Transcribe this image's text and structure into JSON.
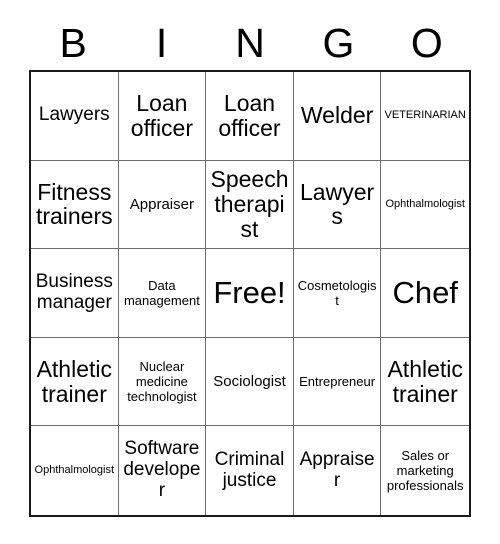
{
  "header": {
    "letters": [
      "B",
      "I",
      "N",
      "G",
      "O"
    ]
  },
  "grid": {
    "rows": 5,
    "columns": 5,
    "border_color": "#1a1a1a",
    "gridline_color": "#6f6f6f",
    "background_color": "#ffffff",
    "text_color": "#000000",
    "cells": [
      {
        "label": "Lawyers",
        "size": "lg"
      },
      {
        "label": "Loan officer",
        "size": "xl"
      },
      {
        "label": "Loan officer",
        "size": "xl"
      },
      {
        "label": "Welder",
        "size": "xl"
      },
      {
        "label": "VETERINARIAN",
        "size": "xs"
      },
      {
        "label": "Fitness trainers",
        "size": "xl"
      },
      {
        "label": "Appraiser",
        "size": "md"
      },
      {
        "label": "Speech therapist",
        "size": "xl"
      },
      {
        "label": "Lawyers",
        "size": "xl"
      },
      {
        "label": "Ophthalmologist",
        "size": "xs"
      },
      {
        "label": "Business manager",
        "size": "lg"
      },
      {
        "label": "Data management",
        "size": "sm"
      },
      {
        "label": "Free!",
        "size": "xxl"
      },
      {
        "label": "Cosmetologist",
        "size": "sm"
      },
      {
        "label": "Chef",
        "size": "xxl"
      },
      {
        "label": "Athletic trainer",
        "size": "xl"
      },
      {
        "label": "Nuclear medicine technologist",
        "size": "sm"
      },
      {
        "label": "Sociologist",
        "size": "md"
      },
      {
        "label": "Entrepreneur",
        "size": "sm"
      },
      {
        "label": "Athletic trainer",
        "size": "xl"
      },
      {
        "label": "Ophthalmologist",
        "size": "xs"
      },
      {
        "label": "Software developer",
        "size": "lg"
      },
      {
        "label": "Criminal justice",
        "size": "lg"
      },
      {
        "label": "Appraiser",
        "size": "lg"
      },
      {
        "label": "Sales or marketing professionals",
        "size": "sm"
      }
    ]
  }
}
